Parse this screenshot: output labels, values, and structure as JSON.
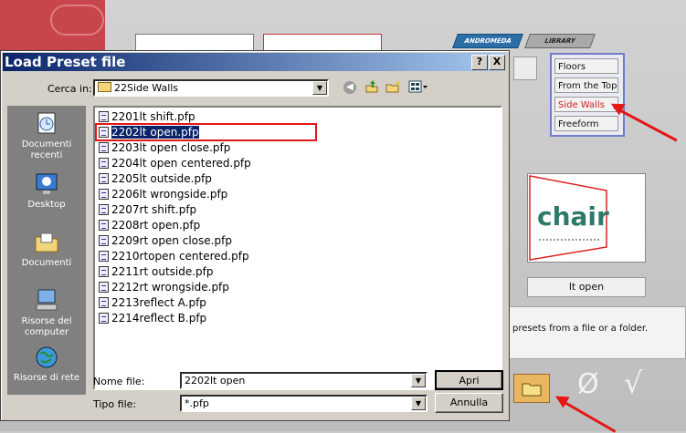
{
  "background_app": {
    "tabs": [
      "ANDROMEDA",
      "LIBRARY"
    ],
    "menu_items": [
      {
        "label": "Floors",
        "selected": false
      },
      {
        "label": "From the Top",
        "selected": false
      },
      {
        "label": "Side Walls",
        "selected": true
      },
      {
        "label": "Freeform",
        "selected": false
      }
    ],
    "preview_text": "chair",
    "preview_label": "lt open",
    "info_text": "presets from a file or a folder.",
    "icons": [
      "folder-icon",
      "null-icon",
      "check-icon"
    ],
    "null_glyph": "Ø",
    "check_glyph": "√"
  },
  "dialog": {
    "title": "Load Preset file",
    "help_label": "?",
    "close_label": "X",
    "look_in_label": "Cerca in:",
    "look_in_value": "22Side Walls",
    "places": [
      "Documenti recenti",
      "Desktop",
      "Documenti",
      "Risorse del computer",
      "Risorse di rete"
    ],
    "files": [
      "2201lt shift.pfp",
      "2202lt open.pfp",
      "2203lt open close.pfp",
      "2204lt open centered.pfp",
      "2205lt outside.pfp",
      "2206lt wrongside.pfp",
      "2207rt shift.pfp",
      "2208rt open.pfp",
      "2209rt open close.pfp",
      "2210rtopen centered.pfp",
      "2211rt outside.pfp",
      "2212rt wrongside.pfp",
      "2213reflect A.pfp",
      "2214reflect B.pfp"
    ],
    "selected_index": 1,
    "filename_label": "Nome file:",
    "filename_value": "2202lt open",
    "filetype_label": "Tipo file:",
    "filetype_value": "*.pfp",
    "open_button": "Apri",
    "cancel_button": "Annulla"
  },
  "colors": {
    "titlebar": "#0a246a",
    "selection": "#0a246a",
    "highlight_red": "#e51616",
    "menu_border": "#6d7dc9"
  }
}
